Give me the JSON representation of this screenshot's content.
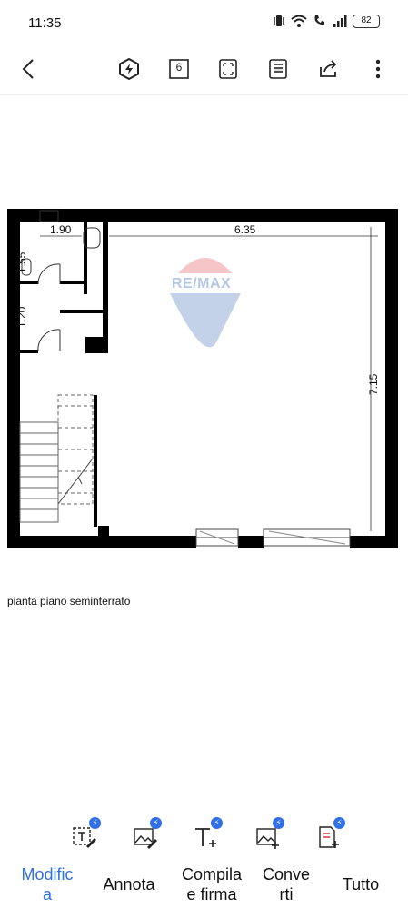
{
  "status": {
    "time": "11:35",
    "battery": "82",
    "icons": [
      "vibrate-icon",
      "wifi-icon",
      "wifi-call-icon",
      "signal-icon"
    ]
  },
  "toolbar": {
    "back_icon": "back-arrow-icon",
    "page_count": "6",
    "icons": [
      "ai-hexagon-icon",
      "page-count-icon",
      "fullscreen-icon",
      "reading-mode-icon",
      "share-icon",
      "more-vertical-icon"
    ]
  },
  "document": {
    "watermark": "RE/MAX",
    "dimensions": {
      "top_left": "1.90",
      "top_main": "6.35",
      "left_upper": "1.55",
      "left_lower": "1.20",
      "right": "7.15"
    },
    "caption": "pianta piano seminterrato"
  },
  "quick_tools": {
    "badge": "⚡",
    "icons": [
      "edit-text-icon",
      "edit-image-icon",
      "add-text-icon",
      "add-image-icon",
      "add-page-icon"
    ]
  },
  "tabs": [
    {
      "label": "Modifica",
      "line1": "Modific",
      "line2": "a",
      "active": true
    },
    {
      "label": "Annota",
      "line1": "Annota",
      "line2": "",
      "active": false
    },
    {
      "label": "Compila e firma",
      "line1": "Compila",
      "line2": "e firma",
      "active": false
    },
    {
      "label": "Converti",
      "line1": "Conve",
      "line2": "rti",
      "active": false
    },
    {
      "label": "Tutto",
      "line1": "Tutto",
      "line2": "",
      "active": false
    }
  ],
  "colors": {
    "accent": "#2f6fe8",
    "wall": "#000000",
    "watermark_red": "#e1313e",
    "watermark_blue": "#2b61b4"
  }
}
